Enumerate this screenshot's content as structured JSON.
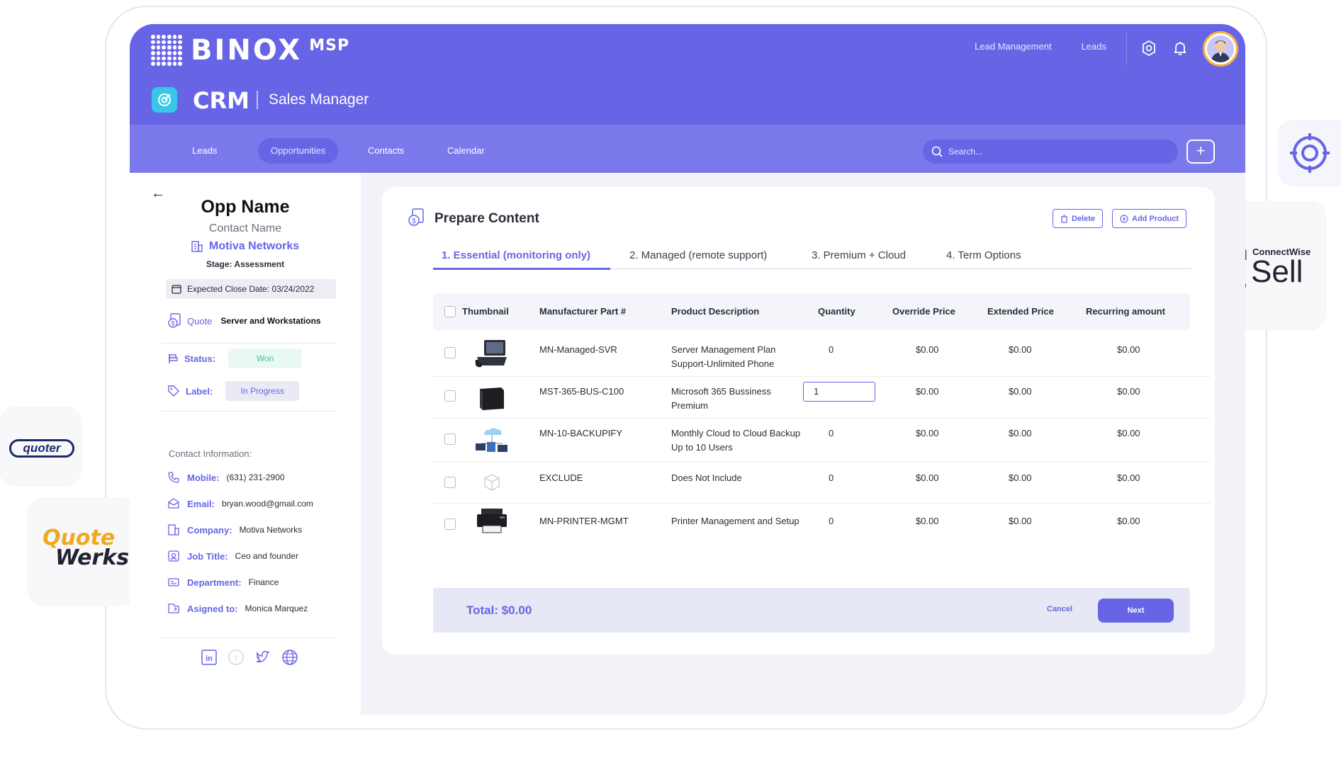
{
  "brand": {
    "name": "BINOX",
    "suffix": "MSP"
  },
  "top_nav": [
    "Lead Management",
    "Leads"
  ],
  "app": {
    "title": "CRM",
    "subtitle": "Sales Manager"
  },
  "main_tabs": [
    {
      "label": "Leads",
      "active": false
    },
    {
      "label": "Opportunities",
      "active": true
    },
    {
      "label": "Contacts",
      "active": false
    },
    {
      "label": "Calendar",
      "active": false
    }
  ],
  "search": {
    "placeholder": "Search..."
  },
  "opportunity": {
    "name": "Opp Name",
    "contact_name": "Contact Name",
    "company": "Motiva Networks",
    "stage": "Stage: Assessment",
    "close_date": "Expected Close Date: 03/24/2022",
    "quote_label": "Quote",
    "quote_value": "Server and Workstations",
    "status_label": "Status:",
    "status_value": "Won",
    "label_label": "Label:",
    "label_value": "In Progress"
  },
  "contact_info": {
    "title": "Contact Information:",
    "rows": [
      {
        "key": "Mobile:",
        "value": "(631) 231-2900",
        "icon": "phone-icon"
      },
      {
        "key": "Email:",
        "value": "bryan.wood@gmail.com",
        "icon": "mail-icon"
      },
      {
        "key": "Company:",
        "value": "Motiva Networks",
        "icon": "building-icon"
      },
      {
        "key": "Job Title:",
        "value": "Ceo and founder",
        "icon": "badge-icon"
      },
      {
        "key": "Department:",
        "value": "Finance",
        "icon": "id-card-icon"
      },
      {
        "key": "Asigned to:",
        "value": "Monica Marquez",
        "icon": "assign-icon"
      }
    ]
  },
  "content": {
    "title": "Prepare Content",
    "delete_label": "Delete",
    "add_product_label": "Add Product",
    "tabs": [
      {
        "label": "1. Essential (monitoring only)",
        "active": true
      },
      {
        "label": "2. Managed (remote support)",
        "active": false
      },
      {
        "label": "3. Premium + Cloud",
        "active": false
      },
      {
        "label": "4. Term Options",
        "active": false
      }
    ],
    "columns": [
      "Thumbnail",
      "Manufacturer Part #",
      "Product Description",
      "Quantity",
      "Override Price",
      "Extended Price",
      "Recurring amount"
    ],
    "rows": [
      {
        "part": "MN-Managed-SVR",
        "desc": "Server Management Plan Support-Unlimited Phone",
        "qty": "0",
        "override": "$0.00",
        "extended": "$0.00",
        "recurring": "$0.00",
        "thumb": "phone-device"
      },
      {
        "part": "MST-365-BUS-C100",
        "desc": "Microsoft 365 Bussiness Premium",
        "qty": "1",
        "override": "$0.00",
        "extended": "$0.00",
        "recurring": "$0.00",
        "thumb": "server-box"
      },
      {
        "part": "MN-10-BACKUPIFY",
        "desc": "Monthly Cloud to Cloud Backup Up to 10 Users",
        "qty": "0",
        "override": "$0.00",
        "extended": "$0.00",
        "recurring": "$0.00",
        "thumb": "cloud-network"
      },
      {
        "part": "EXCLUDE",
        "desc": "Does Not Include",
        "qty": "0",
        "override": "$0.00",
        "extended": "$0.00",
        "recurring": "$0.00",
        "thumb": "empty-box"
      },
      {
        "part": "MN-PRINTER-MGMT",
        "desc": "Printer Management and Setup",
        "qty": "0",
        "override": "$0.00",
        "extended": "$0.00",
        "recurring": "$0.00",
        "thumb": "printer"
      }
    ],
    "total": "Total: $0.00",
    "cancel_label": "Cancel",
    "next_label": "Next"
  },
  "partners": {
    "connectwise_small": "ConnectWise",
    "connectwise_big": "Sell",
    "quoter": "quoter",
    "quotewerks_1": "Quote",
    "quotewerks_2": "Werks"
  },
  "colors": {
    "primary": "#6765e5",
    "tabbar": "#7a78eb",
    "accent_cyan": "#38c7e8",
    "won": "#3fc79a",
    "avatar_ring": "#f4b33d"
  }
}
